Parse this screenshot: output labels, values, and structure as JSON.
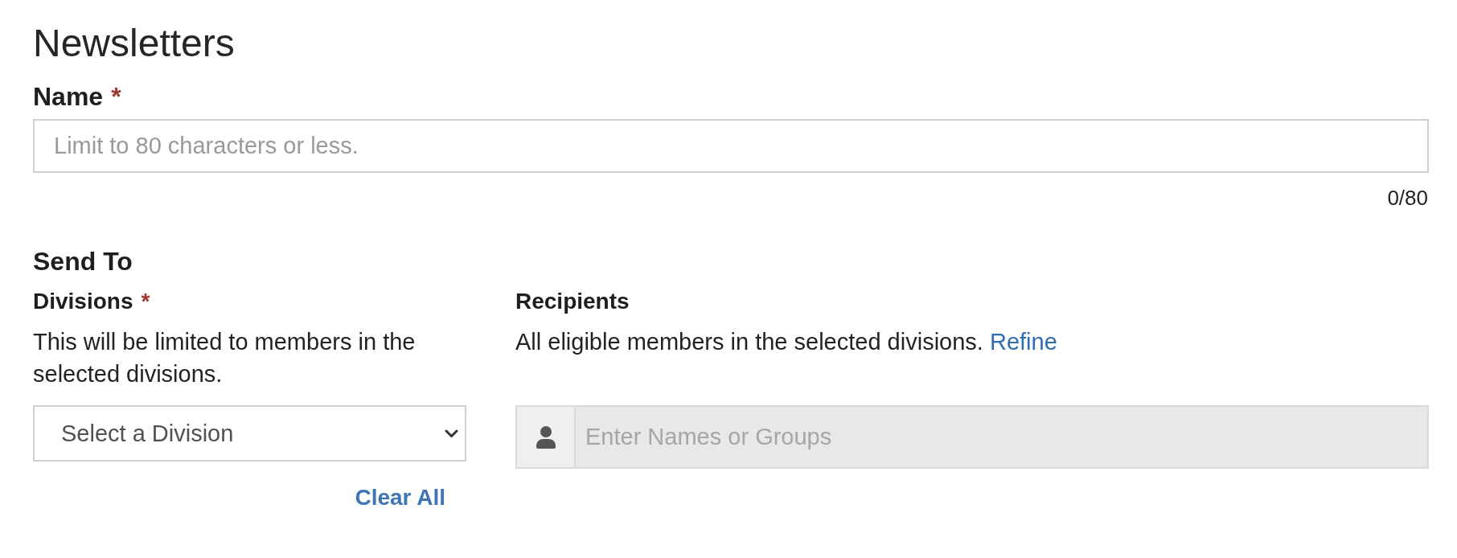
{
  "page": {
    "title": "Newsletters"
  },
  "name_field": {
    "label": "Name",
    "required_mark": "*",
    "placeholder": "Limit to 80 characters or less.",
    "counter": "0/80"
  },
  "send_to": {
    "heading": "Send To",
    "divisions": {
      "label": "Divisions",
      "required_mark": "*",
      "help": "This will be limited to members in the selected divisions.",
      "select": {
        "value": "Select a Division"
      },
      "clear_all": "Clear All"
    },
    "recipients": {
      "label": "Recipients",
      "help": "All eligible members in the selected divisions.",
      "link": "Refine",
      "placeholder": "Enter Names or Groups",
      "disabled": true
    }
  }
}
